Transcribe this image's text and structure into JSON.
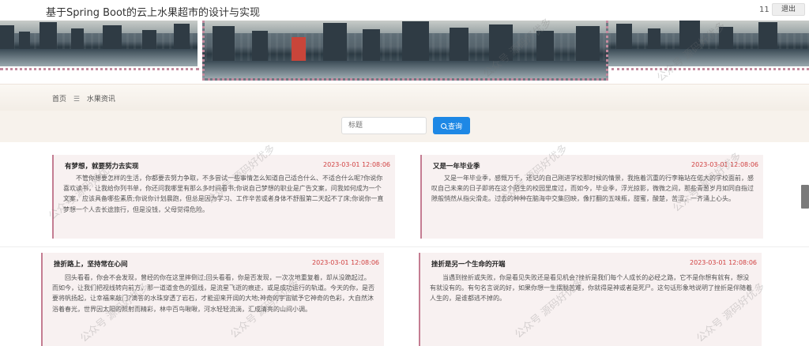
{
  "header": {
    "title": "基于Spring Boot的云上水果超市的设计与实现",
    "user_id": "11",
    "logout_label": "退出"
  },
  "breadcrumb": {
    "home": "首页",
    "separator": "☰",
    "current": "水果资讯"
  },
  "search": {
    "placeholder": "标题",
    "button_label": "查询"
  },
  "articles": [
    {
      "title": "有梦想，就要努力去实现",
      "time": "2023-03-01 12:08:06",
      "content": "不管你想要怎样的生活，你都要去努力争取，不多尝试一些事情怎么知道自己适合什么、不适合什么呢?你说你喜欢读书，让我给你列书单，你还问我哪里有那么多时间看书;你说自己梦想的职业是广告文案，问我如何成为一个文案，应该具备哪些素质;你说你计划晨跑，但总是因为学习、工作辛苦或者身体不舒服第二天起不了床;你说你一直梦想一个人去长途旅行，但是没钱，父母觉得危险。"
    },
    {
      "title": "又是一年毕业季",
      "time": "2023-03-01 12:08:06",
      "content": "又是一年毕业季，感慨万千，还记的自己刚进学校那时候的情景，我拖着沉重的行李箱站在偌大的学校面前，感叹自己未来的日子即将在这个陌生的校园里度过，而如今，毕业季，浮光掠影，微微之间，那些青葱岁月如同自指过隙般悄然从指尖滑走。过去的种种在脑海中交集回映，像打翻的五味瓶，甜蜜，酸楚，苦涩，一齐涌上心头。"
    },
    {
      "title": "挫折路上，坚持常在心间",
      "time": "2023-03-01 12:08:06",
      "content": "回头看看，你会不会发现，曾经的你在这里摔倒过;回头看看，你是否发现，一次次地重复着，却从没跪起过。而如今，让我们把视线转向前方，那一道道金色的弧线，是流星飞逝的痕迹，或是成功运行的轨道。今天的你，是否要将帆扬起，让幸福来敲门?滴答的水珠穿透了岩石，才能迎来开阔的大地;神奇的宇宙赋予它神奇的色彩，大自然沐浴着春光，世界因太阳的照射而精彩，林中百鸟啾啾，河水轻轻流淌，汇成清亮的山间小调。"
    },
    {
      "title": "挫折是另一个生命的开端",
      "time": "2023-03-01 12:08:06",
      "content": "当遇到挫折或失败，你是看见失败还是看见机会?挫折是我们每个人成长的必经之路，它不是你想有就有，想没有就没有的。有句名言说的好，如果你想一生摆脱苦难，你就得是神或者是死尸。这句话形象地说明了挫折是伴随着人生的，是谁都逃不掉的。"
    }
  ],
  "watermark": "公众号 源码好优多"
}
